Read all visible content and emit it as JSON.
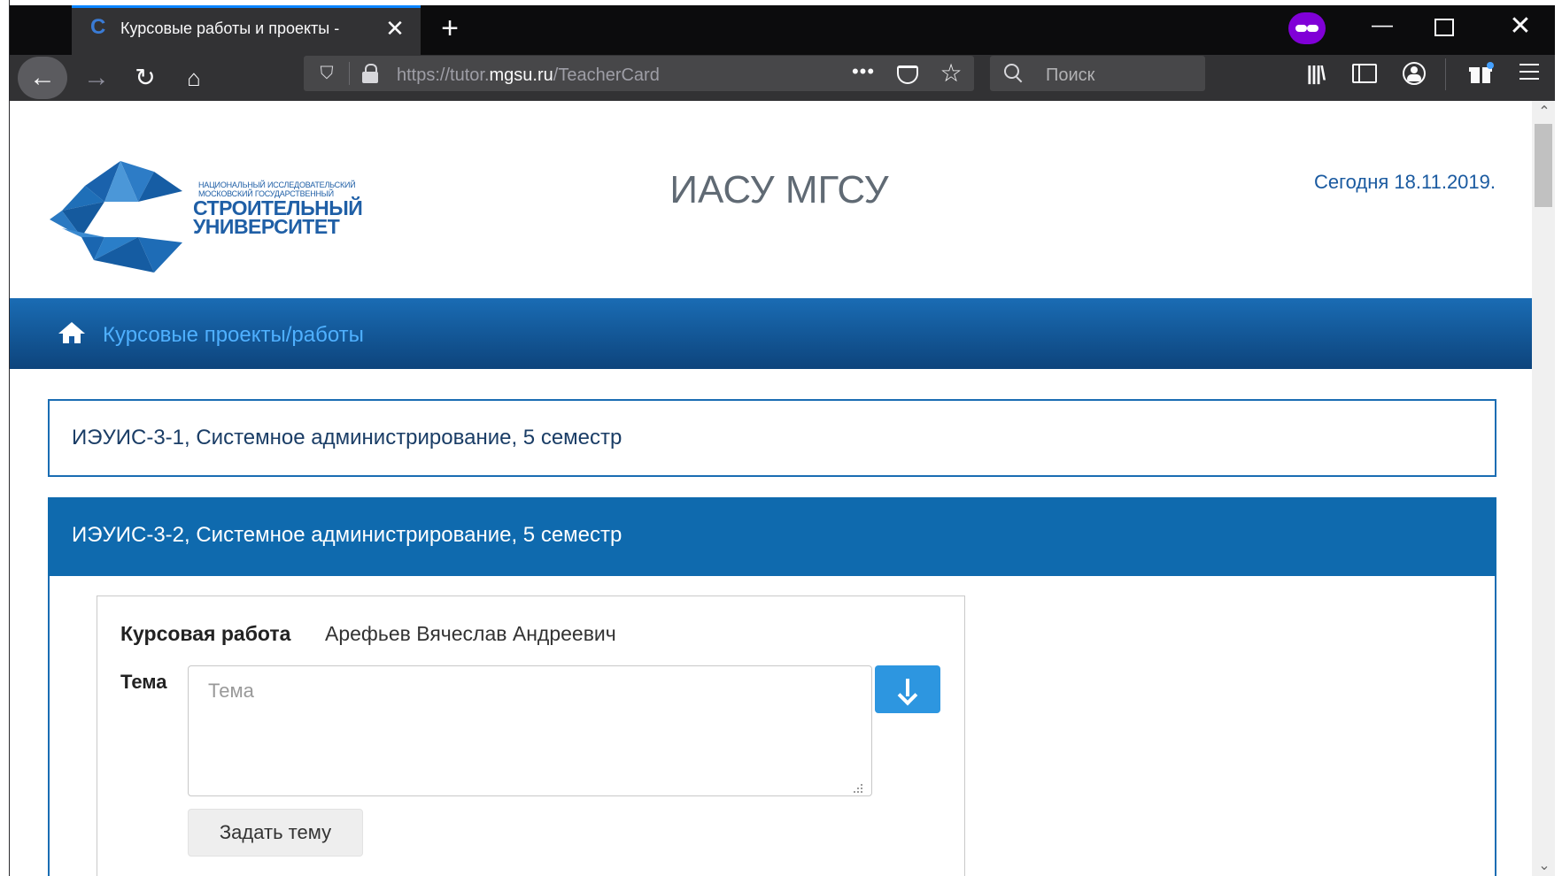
{
  "browser": {
    "tab_title": "Курсовые работы и проекты -",
    "url_prefix": "https://tutor.",
    "url_host": "mgsu.ru",
    "url_path": "/TeacherCard",
    "search_placeholder": "Поиск",
    "new_tab_glyph": "+",
    "close_glyph": "✕",
    "page_actions_glyph": "•••"
  },
  "header": {
    "logo_small_line1": "НАЦИОНАЛЬНЫЙ ИССЛЕДОВАТЕЛЬСКИЙ",
    "logo_small_line2": "МОСКОВСКИЙ ГОСУДАРСТВЕННЫЙ",
    "logo_big_line1": "СТРОИТЕЛЬНЫЙ",
    "logo_big_line2": "УНИВЕРСИТЕТ",
    "site_title": "ИАСУ МГСУ",
    "today": "Сегодня 18.11.2019."
  },
  "navbar": {
    "link_label": "Курсовые проекты/работы"
  },
  "groups": [
    {
      "title": "ИЭУИС-3-1, Системное администрирование, 5 семестр",
      "expanded": false
    },
    {
      "title": "ИЭУИС-3-2, Системное администрирование, 5 семестр",
      "expanded": true
    }
  ],
  "card": {
    "label": "Курсовая работа",
    "student": "Арефьев Вячеслав Андреевич",
    "topic_label": "Тема",
    "topic_placeholder": "Тема",
    "topic_value": "",
    "set_topic_button": "Задать тему"
  },
  "colors": {
    "accent": "#0a84ff",
    "private": "#8000d7",
    "brand_blue": "#1f5fa6",
    "nav_top": "#1a6cb4",
    "nav_bottom": "#0d447c",
    "panel_header": "#0f6aae",
    "action_button": "#2d96e0"
  },
  "icons": {
    "tab_favicon": "c-logo-icon",
    "back": "arrow-left-icon",
    "forward": "arrow-right-icon",
    "reload": "reload-icon",
    "home": "home-icon",
    "tracking": "shield-icon",
    "security": "lock-icon",
    "bookmark": "star-icon",
    "library": "library-icon",
    "download_topic": "arrow-down-icon"
  }
}
